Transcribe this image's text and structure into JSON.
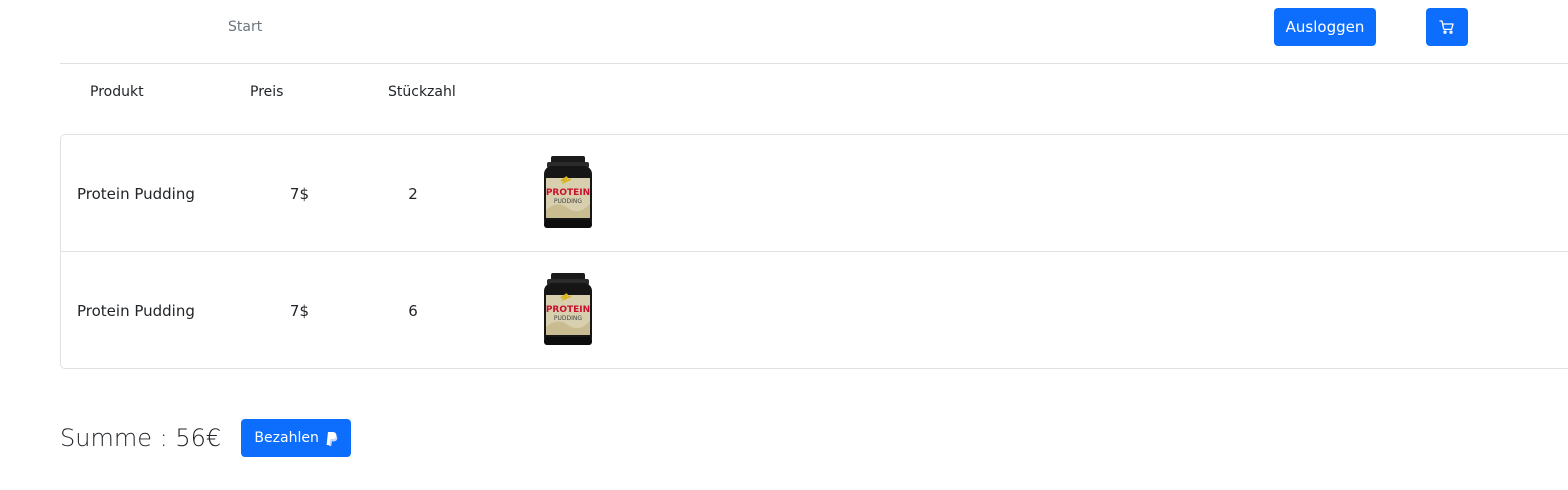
{
  "nav": {
    "start_label": "Start",
    "logout_label": "Ausloggen",
    "cart_icon": "cart-icon"
  },
  "table": {
    "headers": [
      "Produkt",
      "Preis",
      "Stückzahl"
    ],
    "rows": [
      {
        "product": "Protein Pudding",
        "price": "7$",
        "quantity": "2",
        "image_icon": "protein-pudding-jar"
      },
      {
        "product": "Protein Pudding",
        "price": "7$",
        "quantity": "6",
        "image_icon": "protein-pudding-jar"
      }
    ]
  },
  "summary": {
    "sum_label": "Summe : 56€",
    "pay_label": "Bezahlen",
    "pay_icon": "paypal-icon"
  },
  "colors": {
    "primary": "#0d6efd",
    "border": "#dee2e6",
    "muted_text": "#6c757d",
    "text": "#212529"
  }
}
